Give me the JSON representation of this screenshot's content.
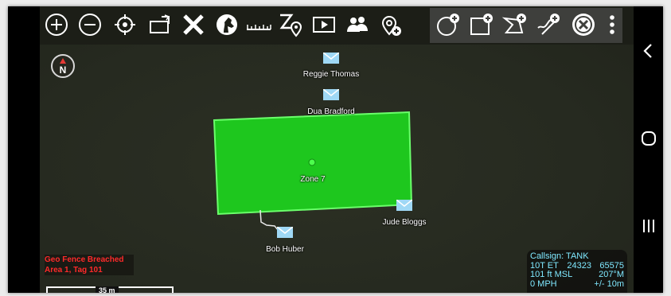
{
  "toolbar": {
    "icons": [
      "zoom-in-icon",
      "zoom-out-icon",
      "locate-self-icon",
      "rotate-icon",
      "close-tools-icon",
      "horse-head-icon",
      "ruler-icon",
      "bearing-pin-icon",
      "video-icon",
      "team-icon",
      "add-pin-icon"
    ],
    "drawing_group": [
      "draw-circle-icon",
      "draw-rectangle-icon",
      "draw-polygon-icon",
      "draw-freehand-icon",
      "cancel-drawing-icon"
    ],
    "overflow": "more-options-icon"
  },
  "compass": {
    "letter": "N"
  },
  "markers": {
    "reggie": "Reggie Thomas",
    "dua": "Dua Bradford",
    "zone": "Zone 7",
    "jude": "Jude Bloggs",
    "bob": "Bob Huber"
  },
  "alert": {
    "line1": "Geo Fence Breached",
    "line2": "Area 1, Tag 101"
  },
  "scale": {
    "label": "35 m"
  },
  "info": {
    "callsign": "Callsign: TANK",
    "grid_zone": "10T  ET",
    "easting": "24323",
    "northing": "65575",
    "altitude": "101 ft MSL",
    "heading": "207°M",
    "speed": "0 MPH",
    "accuracy": "+/- 10m"
  },
  "colors": {
    "map_bg": "#262a20",
    "zone_fill": "#1ec71e",
    "zone_stroke": "#6bff6b",
    "alert_text": "#ff2a2a",
    "info_text": "#7fe8ff",
    "marker_blue": "#9fd8f5"
  },
  "navbar": {
    "icons": [
      "back-icon",
      "home-icon",
      "recents-icon"
    ]
  }
}
